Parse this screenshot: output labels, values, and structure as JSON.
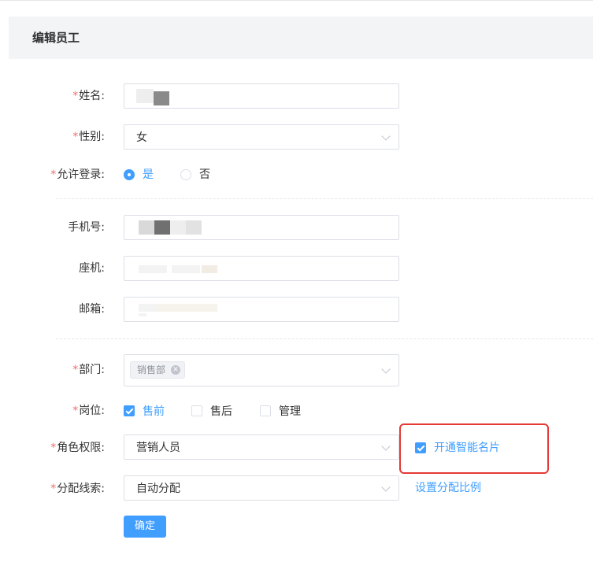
{
  "header": {
    "title": "编辑员工"
  },
  "form": {
    "name": {
      "label": "姓名:",
      "required": true
    },
    "gender": {
      "label": "性别:",
      "required": true,
      "value": "女"
    },
    "allow_login": {
      "label": "允许登录:",
      "required": true,
      "options": [
        "是",
        "否"
      ],
      "selected": "是"
    },
    "phone": {
      "label": "手机号:"
    },
    "landline": {
      "label": "座机:"
    },
    "email": {
      "label": "邮箱:"
    },
    "department": {
      "label": "部门:",
      "required": true,
      "tags": [
        "销售部"
      ]
    },
    "position": {
      "label": "岗位:",
      "required": true,
      "options": [
        {
          "label": "售前",
          "checked": true
        },
        {
          "label": "售后",
          "checked": false
        },
        {
          "label": "管理",
          "checked": false
        }
      ]
    },
    "role": {
      "label": "角色权限:",
      "required": true,
      "value": "营销人员"
    },
    "smart_card": {
      "label": "开通智能名片",
      "checked": true
    },
    "lead_assign": {
      "label": "分配线索:",
      "required": true,
      "value": "自动分配",
      "link": "设置分配比例"
    },
    "submit_label": "确定"
  },
  "colors": {
    "primary": "#409eff",
    "required": "#f56c6c",
    "highlight": "#e53935"
  }
}
